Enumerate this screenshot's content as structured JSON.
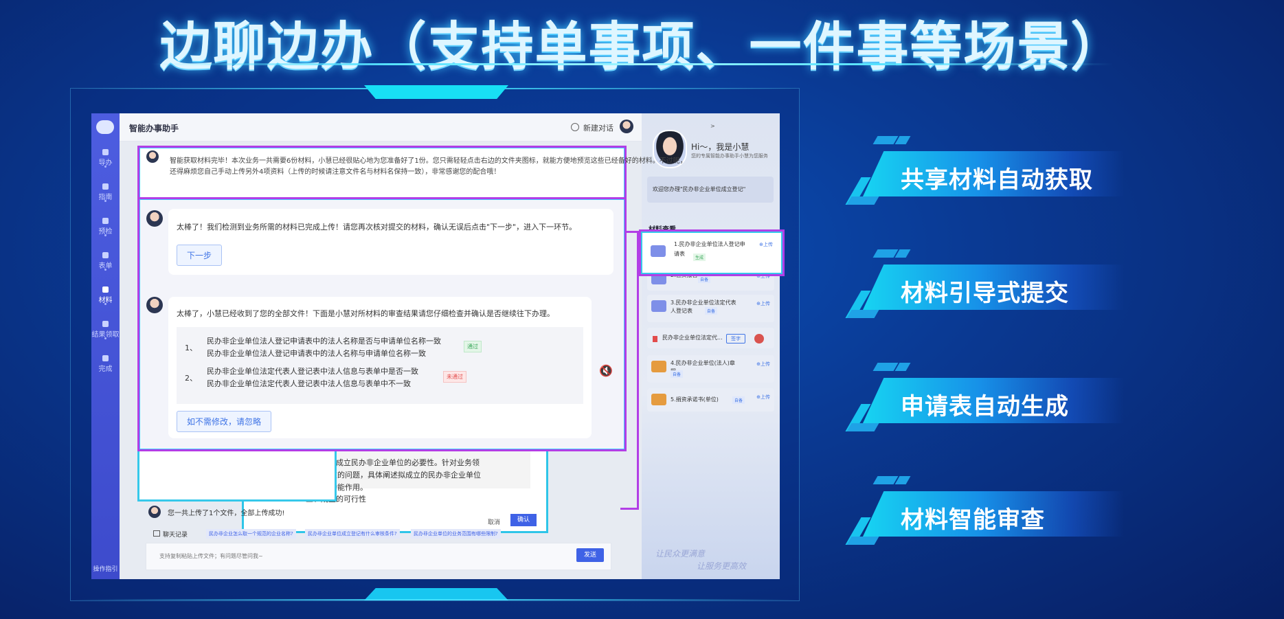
{
  "page": {
    "title": "边聊边办（支持单事项、一件事等场景）"
  },
  "features": [
    "共享材料自动获取",
    "材料引导式提交",
    "申请表自动生成",
    "材料智能审查"
  ],
  "app": {
    "title": "智能办事助手",
    "new_chat": "新建对话",
    "nav": [
      "导办",
      "指南",
      "预检",
      "表单",
      "材料",
      "结果领取",
      "完成"
    ],
    "footer": "操作指引"
  },
  "right_panel": {
    "arrow": ">",
    "greeting": "Hi～，我是小慧",
    "subtitle": "您的专属智能办事助手小慧为您服务",
    "welcome": "欢迎您办理\"民办非企业单位成立登记\"",
    "section": "材料查看",
    "items": [
      {
        "name": "1.民办非企业单位法人登记申请表",
        "upload": "⊕上传",
        "tag": "生成"
      },
      {
        "name": "2.验资报告",
        "upload": "⊕上传",
        "tag": "自备"
      },
      {
        "name": "3.民办非企业单位法定代表人登记表",
        "upload": "⊕上传",
        "tag": "自备"
      },
      {
        "name": "民办非企业单位法定代...",
        "sign": "签字"
      },
      {
        "name": "4.民办非企业单位(法人)章程",
        "upload": "⊕上传",
        "tag": "自备"
      },
      {
        "name": "5.捐资承诺书(单位)",
        "upload": "⊕上传",
        "tag": "自备"
      }
    ],
    "slogan1": "让民众更满意",
    "slogan2": "让服务更高效"
  },
  "chat": {
    "msg_top": "智能获取材料完毕！本次业务一共需要6份材料，小慧已经很贴心地为您准备好了1份。您只需轻轻点击右边的文件夹图标，就能方便地预览这些已经备好的材料。不过呢，还得麻烦您自己手动上传另外4项资料（上传的时候请注意文件名与材料名保持一致），非常感谢您的配合哦！",
    "msg1": "太棒了！我们检测到业务所需的材料已完成上传！请您再次核对提交的材料，确认无误后点击\"下一步\"，进入下一环节。",
    "next_button": "下一步",
    "msg2": "太棒了，小慧已经收到了您的全部文件！下面是小慧对所材料的审查结果请您仔细检查并确认是否继续往下办理。",
    "checks": [
      {
        "num": "1、",
        "line1": "民办非企业单位法人登记申请表中的法人名称是否与申请单位名称一致",
        "line2": "民办非企业单位法人登记申请表中的法人名称与申请单位名称一致",
        "status": "通过"
      },
      {
        "num": "2、",
        "line1": "民办非企业单位法定代表人登记表中法人信息与表单中是否一致",
        "line2": "民办非企业单位法定代表人登记表中法人信息与表单中不一致",
        "status": "未通过"
      }
    ],
    "ignore_button": "如不需修改，请忽略",
    "upload_msg": "您一共上传了1个文件，全部上传成功!",
    "history": "聊天记录",
    "suggestions": [
      "民办非企业怎么取一个规范的企业名称?",
      "民办非企业单位成立登记有什么审核条件?",
      "民办非企业单位的业务范围有哪些限制?"
    ],
    "input_placeholder": "支持复制粘贴上传文件；有问题尽管问我~",
    "send": "发送"
  },
  "doc": {
    "lines": [
      "充分论证成立民办非企业单位的必要性。针对业务领",
      "域发展中存在的问题，具体阐述拟成立的民办非企业单位",
      "所能发挥的功能作用。",
      "三、成立的可行性"
    ],
    "cancel": "取消",
    "ok": "确认",
    "close": "✕"
  }
}
